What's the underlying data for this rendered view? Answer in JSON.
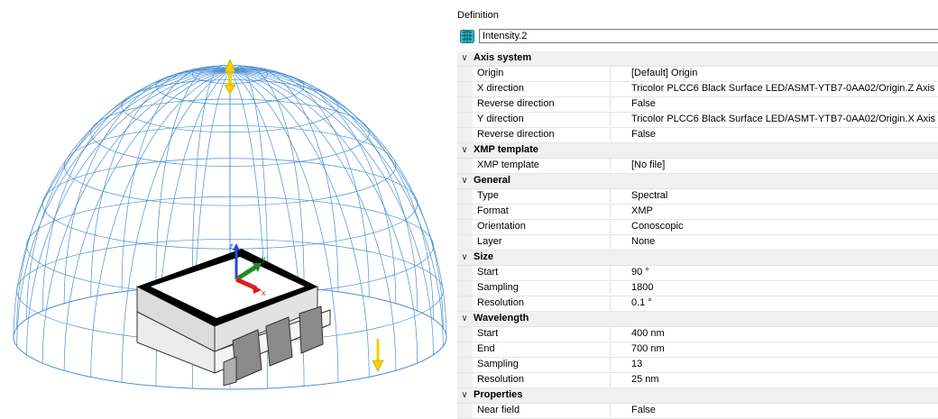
{
  "panel": {
    "title": "Definition",
    "name_value": "Intensity.2",
    "icon": "intensity-sensor-icon",
    "categories": [
      {
        "label": "Axis system",
        "props": [
          {
            "name": "Origin",
            "value": "[Default] Origin"
          },
          {
            "name": "X direction",
            "value": "Tricolor PLCC6 Black Surface LED/ASMT-YTB7-0AA02/Origin.Z Axis"
          },
          {
            "name": "Reverse direction",
            "value": "False"
          },
          {
            "name": "Y direction",
            "value": "Tricolor PLCC6 Black Surface LED/ASMT-YTB7-0AA02/Origin.X Axis"
          },
          {
            "name": "Reverse direction",
            "value": "False"
          }
        ]
      },
      {
        "label": "XMP template",
        "props": [
          {
            "name": "XMP template",
            "value": "[No file]"
          }
        ]
      },
      {
        "label": "General",
        "props": [
          {
            "name": "Type",
            "value": "Spectral"
          },
          {
            "name": "Format",
            "value": "XMP"
          },
          {
            "name": "Orientation",
            "value": "Conoscopic"
          },
          {
            "name": "Layer",
            "value": "None"
          }
        ]
      },
      {
        "label": "Size",
        "props": [
          {
            "name": "Start",
            "value": "90 °"
          },
          {
            "name": "Sampling",
            "value": "1800"
          },
          {
            "name": "Resolution",
            "value": "0.1 °"
          }
        ]
      },
      {
        "label": "Wavelength",
        "props": [
          {
            "name": "Start",
            "value": "400 nm"
          },
          {
            "name": "End",
            "value": "700 nm"
          },
          {
            "name": "Sampling",
            "value": "13"
          },
          {
            "name": "Resolution",
            "value": "25 nm"
          }
        ]
      },
      {
        "label": "Properties",
        "props": [
          {
            "name": "Near field",
            "value": "False"
          }
        ]
      }
    ]
  },
  "viewport": {
    "axis_labels": {
      "x": "x",
      "y": "y",
      "z": "z"
    },
    "colors": {
      "mesh": "#4a8fd4",
      "arrow": "#f5d000",
      "x_axis": "#d82020",
      "y_axis": "#1f8a2a",
      "z_axis": "#2a48d8"
    }
  }
}
